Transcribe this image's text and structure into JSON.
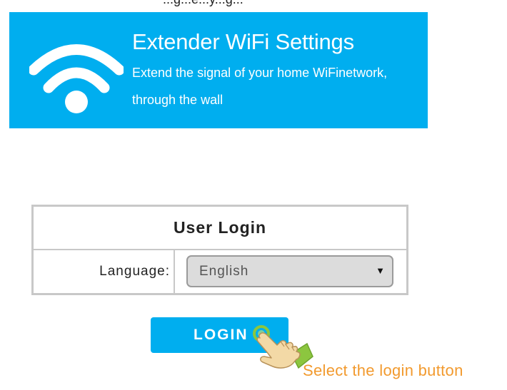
{
  "top_cut_text": "...g...e...y...g...",
  "banner": {
    "title": "Extender WiFi Settings",
    "subtitle_line1": "Extend the signal of your home WiFinetwork,",
    "subtitle_line2": "through the wall",
    "background_color": "#00aeef",
    "icon": "wifi-icon"
  },
  "login": {
    "title": "User Login",
    "language_label": "Language:",
    "language_selected": "English",
    "language_arrow": "▼",
    "button_label": "LOGIN",
    "button_color": "#00aeef"
  },
  "hint": {
    "text": "Select the login button",
    "color": "#f29a2e",
    "icon": "pointing-hand-icon"
  }
}
